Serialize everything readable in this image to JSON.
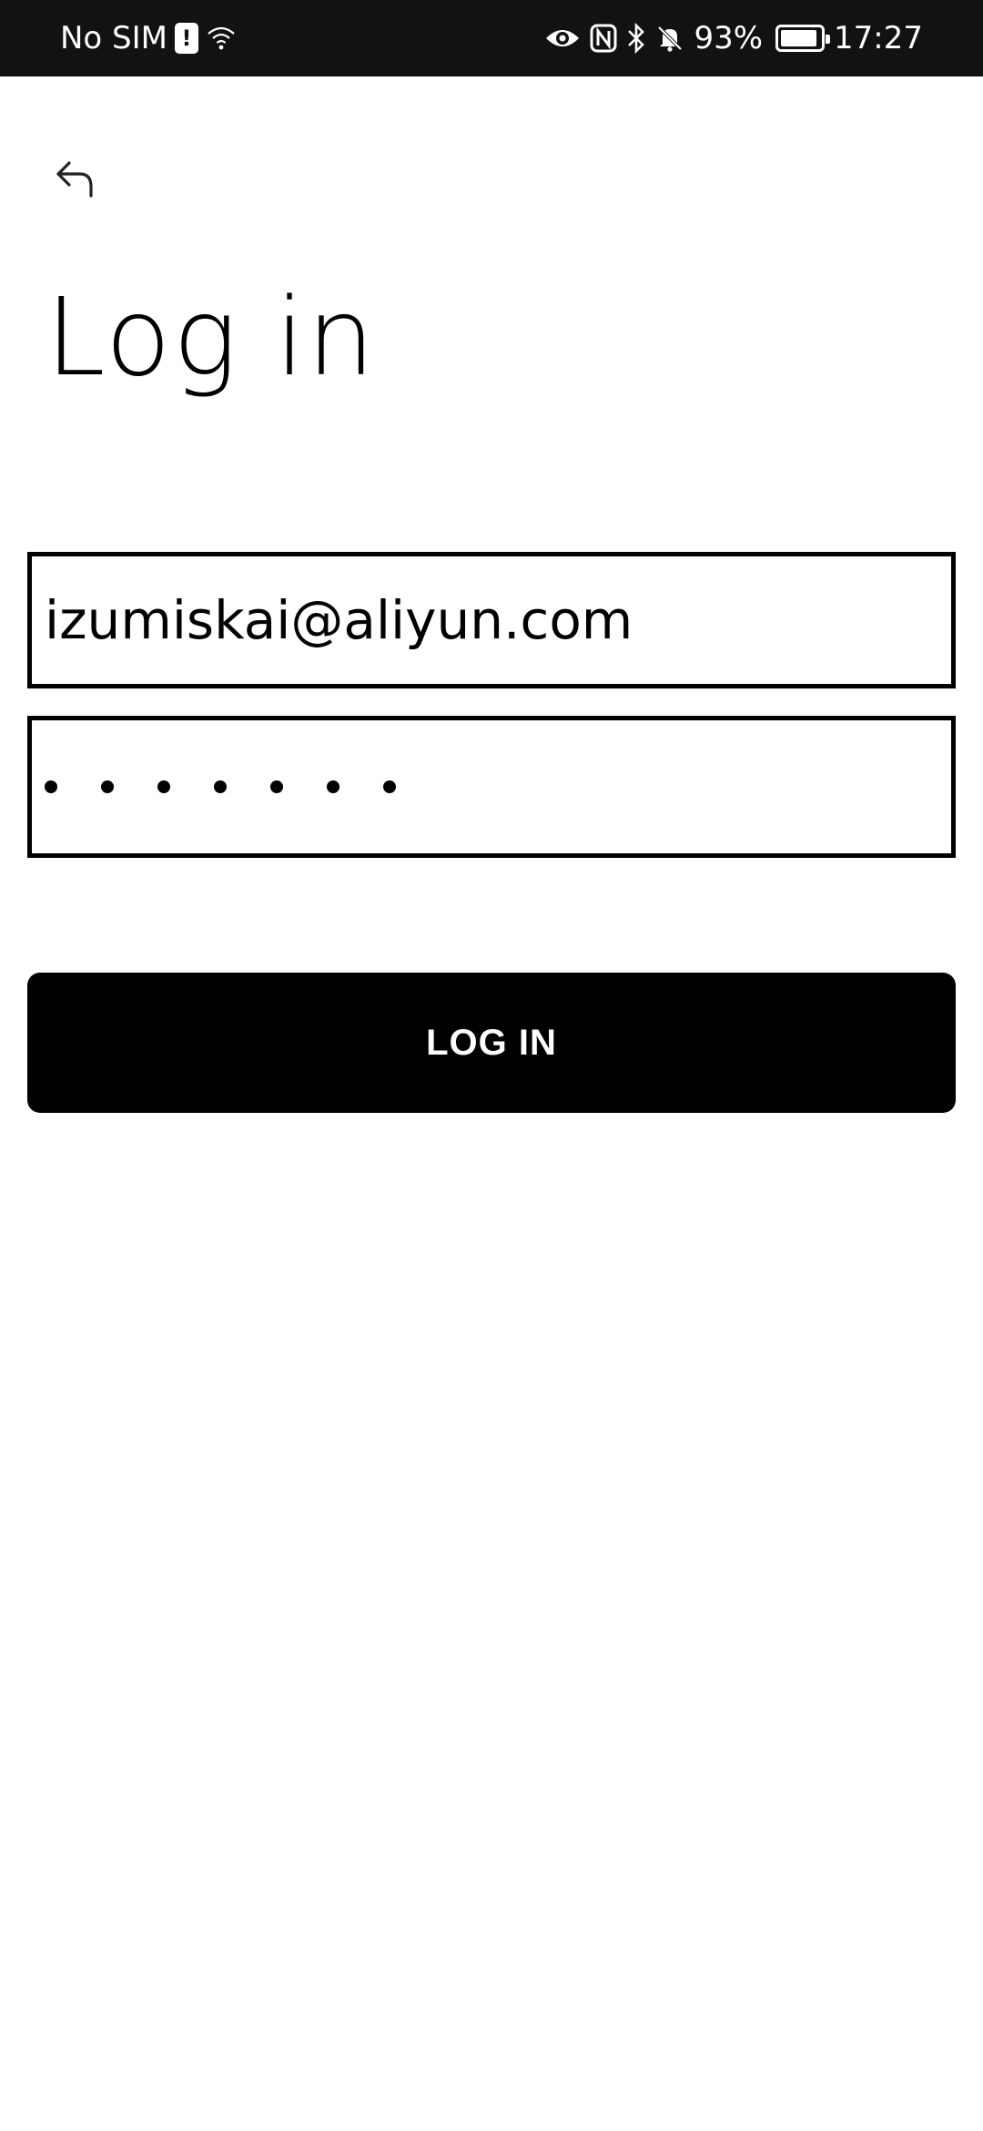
{
  "status_bar": {
    "carrier": "No SIM",
    "battery_percent": "93%",
    "battery_level": 0.93,
    "time": "17:27",
    "icons": [
      "sim-alert-icon",
      "wifi-icon",
      "eye-icon",
      "nfc-icon",
      "bluetooth-icon",
      "bell-off-icon",
      "battery-icon"
    ]
  },
  "header": {
    "back_icon": "back-arrow-icon",
    "title": "Log in"
  },
  "form": {
    "email": {
      "value": "izumiskai@aliyun.com"
    },
    "password": {
      "masked_length": 7
    },
    "submit_label": "LOG IN"
  },
  "colors": {
    "status_bar_bg": "#121212",
    "text": "#000000",
    "background": "#ffffff",
    "button_bg": "#000000",
    "button_text": "#ffffff"
  }
}
